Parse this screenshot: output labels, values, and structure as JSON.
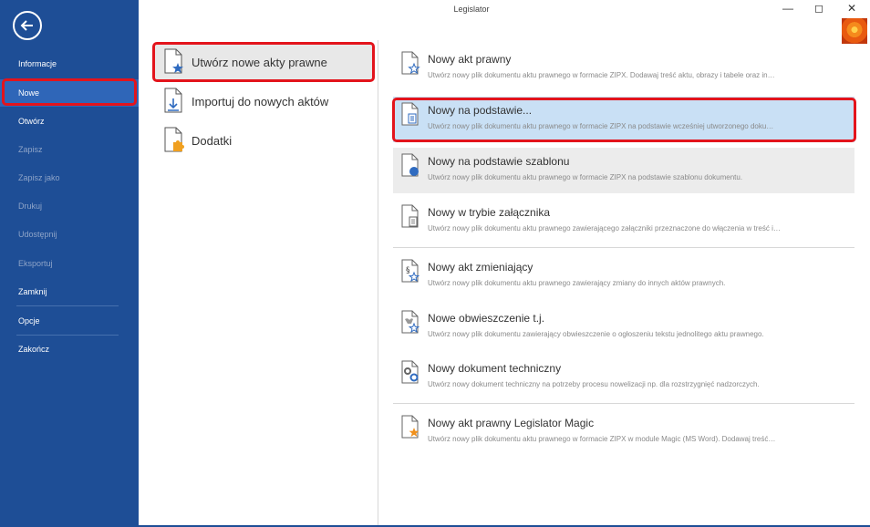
{
  "window": {
    "title": "Legislator",
    "minimize_icon": "minimize-icon",
    "maximize_icon": "maximize-icon",
    "close_icon": "close-icon"
  },
  "sidebar": {
    "back_icon": "back-arrow-icon",
    "items": [
      {
        "label": "Informacje",
        "state": "enabled"
      },
      {
        "label": "Nowe",
        "state": "selected"
      },
      {
        "label": "Otwórz",
        "state": "enabled"
      },
      {
        "label": "Zapisz",
        "state": "disabled"
      },
      {
        "label": "Zapisz jako",
        "state": "disabled"
      },
      {
        "label": "Drukuj",
        "state": "disabled"
      },
      {
        "label": "Udostępnij",
        "state": "disabled"
      },
      {
        "label": "Eksportuj",
        "state": "disabled"
      },
      {
        "label": "Zamknij",
        "state": "enabled"
      },
      {
        "label": "Opcje",
        "state": "enabled"
      },
      {
        "label": "Zakończ",
        "state": "enabled"
      }
    ]
  },
  "categories": [
    {
      "label": "Utwórz nowe akty prawne",
      "icon": "document-star-icon",
      "selected": true
    },
    {
      "label": "Importuj do nowych aktów",
      "icon": "document-import-icon",
      "selected": false
    },
    {
      "label": "Dodatki",
      "icon": "document-puzzle-icon",
      "selected": false
    }
  ],
  "options": [
    {
      "title": "Nowy akt prawny",
      "desc": "Utwórz nowy plik dokumentu aktu prawnego w formacie ZIPX. Dodawaj treść aktu, obrazy i tabele oraz in…",
      "icon": "document-star-icon",
      "state": "normal"
    },
    {
      "title": "Nowy na podstawie...",
      "desc": "Utwórz nowy plik dokumentu aktu prawnego w formacie ZIPX na podstawie wcześniej utworzonego doku…",
      "icon": "document-copy-icon",
      "state": "selected"
    },
    {
      "title": "Nowy na podstawie szablonu",
      "desc": "Utwórz nowy plik dokumentu aktu prawnego w formacie ZIPX na podstawie szablonu dokumentu.",
      "icon": "document-template-icon",
      "state": "hover"
    },
    {
      "title": "Nowy w trybie załącznika",
      "desc": "Utwórz nowy plik dokumentu aktu prawnego zawierającego załączniki przeznaczone do włączenia w treść i…",
      "icon": "document-attachment-icon",
      "state": "normal"
    },
    {
      "title": "Nowy akt zmieniający",
      "desc": "Utwórz nowy plik dokumentu aktu prawnego zawierający zmiany do innych aktów prawnych.",
      "icon": "document-paragraph-icon",
      "state": "normal"
    },
    {
      "title": "Nowe obwieszczenie t.j.",
      "desc": "Utwórz nowy plik dokumentu zawierający obwieszczenie o ogłoszeniu tekstu jednolitego aktu prawnego.",
      "icon": "document-emblem-icon",
      "state": "normal"
    },
    {
      "title": "Nowy dokument techniczny",
      "desc": "Utwórz nowy dokument techniczny na potrzeby procesu nowelizacji np. dla rozstrzygnięć nadzorczych.",
      "icon": "document-gear-icon",
      "state": "normal"
    },
    {
      "title": "Nowy akt prawny Legislator Magic",
      "desc": "Utwórz nowy plik dokumentu aktu prawnego w formacie ZIPX w module Magic (MS Word). Dodawaj treść…",
      "icon": "document-magic-star-icon",
      "state": "normal"
    }
  ],
  "colors": {
    "sidebar_bg": "#1e4e96",
    "sidebar_selected": "#2f66b8",
    "highlight_box": "#e3141c",
    "option_selected": "#c9e0f5"
  }
}
